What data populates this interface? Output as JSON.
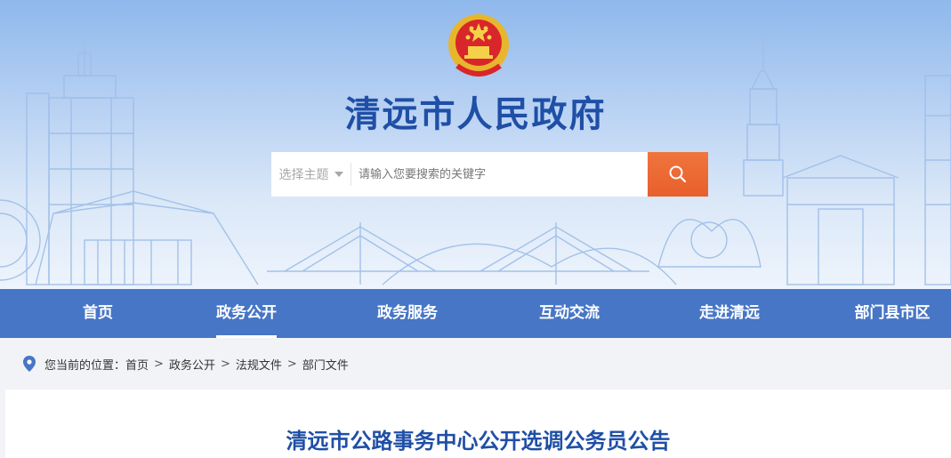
{
  "header": {
    "site_title": "清远市人民政府",
    "emblem_icon": "national-emblem-icon",
    "brand_color": "#1f4fa6"
  },
  "search": {
    "topic_label": "选择主题",
    "placeholder": "请输入您要搜索的关键字",
    "button_icon": "search-icon",
    "button_color": "#e8672f"
  },
  "nav": {
    "items": [
      {
        "label": "首页"
      },
      {
        "label": "政务公开"
      },
      {
        "label": "政务服务"
      },
      {
        "label": "互动交流"
      },
      {
        "label": "走进清远"
      },
      {
        "label": "部门县市区"
      }
    ],
    "active_label": "政务公开",
    "background": "#4876c6"
  },
  "breadcrumb": {
    "icon": "location-pin-icon",
    "prefix": "您当前的位置：",
    "items": [
      "首页",
      "政务公开",
      "法规文件",
      "部门文件"
    ],
    "separator": ">"
  },
  "article": {
    "title": "清远市公路事务中心公开选调公务员公告"
  }
}
